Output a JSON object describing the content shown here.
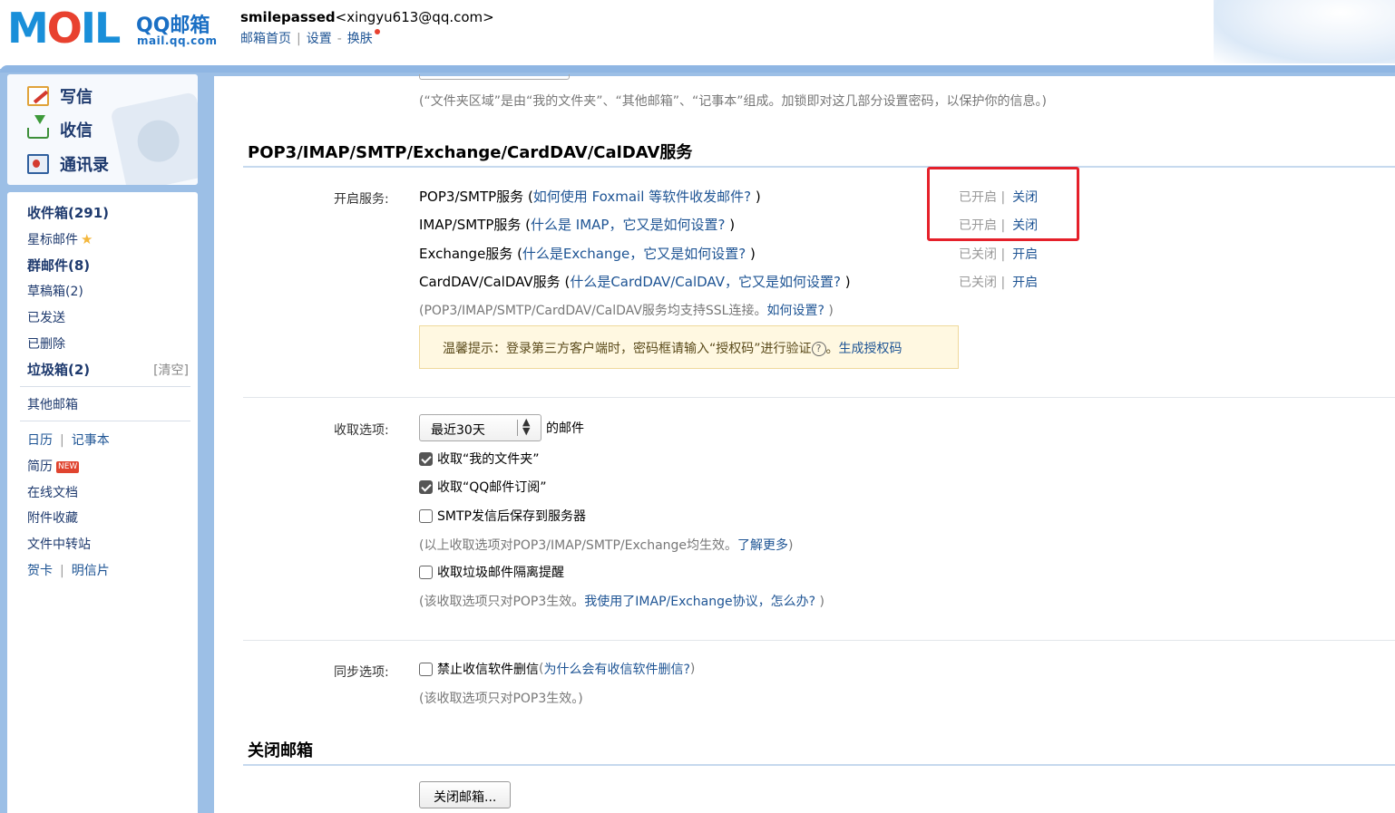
{
  "header": {
    "logo_text": "MOIL",
    "logo_title": "QQ邮箱",
    "logo_url": "mail.qq.com",
    "user_name": "smilepassed",
    "user_email": "<xingyu613@qq.com>",
    "links": [
      "邮箱首页",
      "设置",
      "换肤"
    ],
    "sep_pipe": "|",
    "sep_dash": "-"
  },
  "sidebar": {
    "actions": [
      {
        "label": "写信",
        "icon": "write-icon"
      },
      {
        "label": "收信",
        "icon": "receive-icon"
      },
      {
        "label": "通讯录",
        "icon": "contacts-icon"
      }
    ],
    "folders": {
      "inbox": "收件箱(291)",
      "starred": "星标邮件",
      "group": "群邮件(8)",
      "drafts": "草稿箱(2)",
      "sent": "已发送",
      "deleted": "已删除",
      "junk": "垃圾箱(2)",
      "junk_clear": "[清空]",
      "other": "其他邮箱"
    },
    "tools": {
      "calendar": "日历",
      "notes": "记事本",
      "resume": "简历",
      "new_badge": "NEW",
      "docs": "在线文档",
      "attachments": "附件收藏",
      "transfer": "文件中转站",
      "cards": "贺卡",
      "postcard": "明信片",
      "pipe": "|"
    }
  },
  "content": {
    "folder_note": "(“文件夹区域”是由“我的文件夹”、“其他邮箱”、“记事本”组成。加锁即对这几部分设置密码，以保护你的信息。)",
    "services_title": "POP3/IMAP/SMTP/Exchange/CardDAV/CalDAV服务",
    "services_label": "开启服务:",
    "services": [
      {
        "name": "POP3/SMTP服务",
        "open": " (",
        "help": "如何使用 Foxmail 等软件收发邮件?",
        "close": " )",
        "status": "已开启",
        "action": "关闭"
      },
      {
        "name": "IMAP/SMTP服务",
        "open": " (",
        "help": "什么是 IMAP，它又是如何设置?",
        "close": " )",
        "status": "已开启",
        "action": "关闭"
      },
      {
        "name": "Exchange服务",
        "open": " (",
        "help": "什么是Exchange，它又是如何设置?",
        "close": " )",
        "status": "已关闭",
        "action": "开启"
      },
      {
        "name": "CardDAV/CalDAV服务",
        "open": " (",
        "help": "什么是CardDAV/CalDAV，它又是如何设置?",
        "close": " )",
        "status": "已关闭",
        "action": "开启"
      }
    ],
    "status_sep": "|",
    "ssl_note": "(POP3/IMAP/SMTP/CardDAV/CalDAV服务均支持SSL连接。",
    "ssl_link": "如何设置?",
    "ssl_close": " )",
    "tip_text": "温馨提示：登录第三方客户端时，密码框请输入“授权码”进行验证",
    "tip_q": "?",
    "tip_period": "。",
    "tip_link": "生成授权码",
    "fetch_label": "收取选项:",
    "fetch_select": "最近30天",
    "fetch_suffix": "的邮件",
    "fetch_options": [
      {
        "label": "收取“我的文件夹”",
        "checked": true
      },
      {
        "label": "收取“QQ邮件订阅”",
        "checked": true
      },
      {
        "label": "SMTP发信后保存到服务器",
        "checked": false
      }
    ],
    "fetch_note": "(以上收取选项对POP3/IMAP/SMTP/Exchange均生效。",
    "fetch_note_link": "了解更多",
    "fetch_note_close": ")",
    "junk_option": "收取垃圾邮件隔离提醒",
    "junk_note": "(该收取选项只对POP3生效。",
    "junk_note_link": "我使用了IMAP/Exchange协议，怎么办?",
    "junk_note_close": " )",
    "sync_label": "同步选项:",
    "sync_option": "禁止收信软件删信",
    "sync_help_open": " (",
    "sync_help": "为什么会有收信软件删信?",
    "sync_help_close": " )",
    "sync_note": "(该收取选项只对POP3生效。)",
    "close_title": "关闭邮箱",
    "close_button": "关闭邮箱..."
  },
  "colors": {
    "highlight_box": "#e5202a",
    "link": "#1e5494",
    "frame": "#9cbfe6"
  }
}
